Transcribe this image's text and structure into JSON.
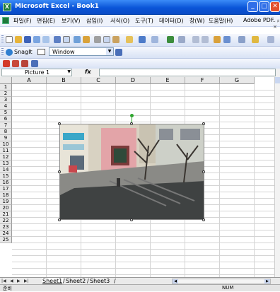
{
  "window": {
    "title": "Microsoft Excel - Book1",
    "minimize": "_",
    "maximize": "□",
    "close": "✕"
  },
  "menu": {
    "items": [
      "파일(F)",
      "편집(E)",
      "보기(V)",
      "삽입(I)",
      "서식(O)",
      "도구(T)",
      "데이터(D)",
      "창(W)",
      "도움말(H)",
      "Adobe PDF"
    ],
    "right_controls": "– ♯ ×"
  },
  "snagit_toolbar": {
    "snagit_label": "SnagIt",
    "capture_mode": "Window"
  },
  "formula_bar": {
    "name_box": "Picture 1",
    "fx_label": "fx",
    "formula": ""
  },
  "grid": {
    "columns": [
      "A",
      "B",
      "C",
      "D",
      "E",
      "F",
      "G"
    ],
    "rows": [
      "1",
      "2",
      "3",
      "4",
      "5",
      "6",
      "7",
      "8",
      "9",
      "10",
      "11",
      "12",
      "13",
      "14",
      "15",
      "16",
      "17",
      "18",
      "19",
      "20",
      "21",
      "22",
      "23",
      "24",
      "25"
    ]
  },
  "picture": {
    "name": "Picture 1"
  },
  "sheets": {
    "tabs": [
      "Sheet1",
      "Sheet2",
      "Sheet3"
    ],
    "active": "Sheet1"
  },
  "status": {
    "ready": "준비",
    "num": "NUM"
  },
  "colors": {
    "title_bar": "#0a55d8",
    "close_button": "#e2502c",
    "selection_handle": "#2ea52e"
  }
}
